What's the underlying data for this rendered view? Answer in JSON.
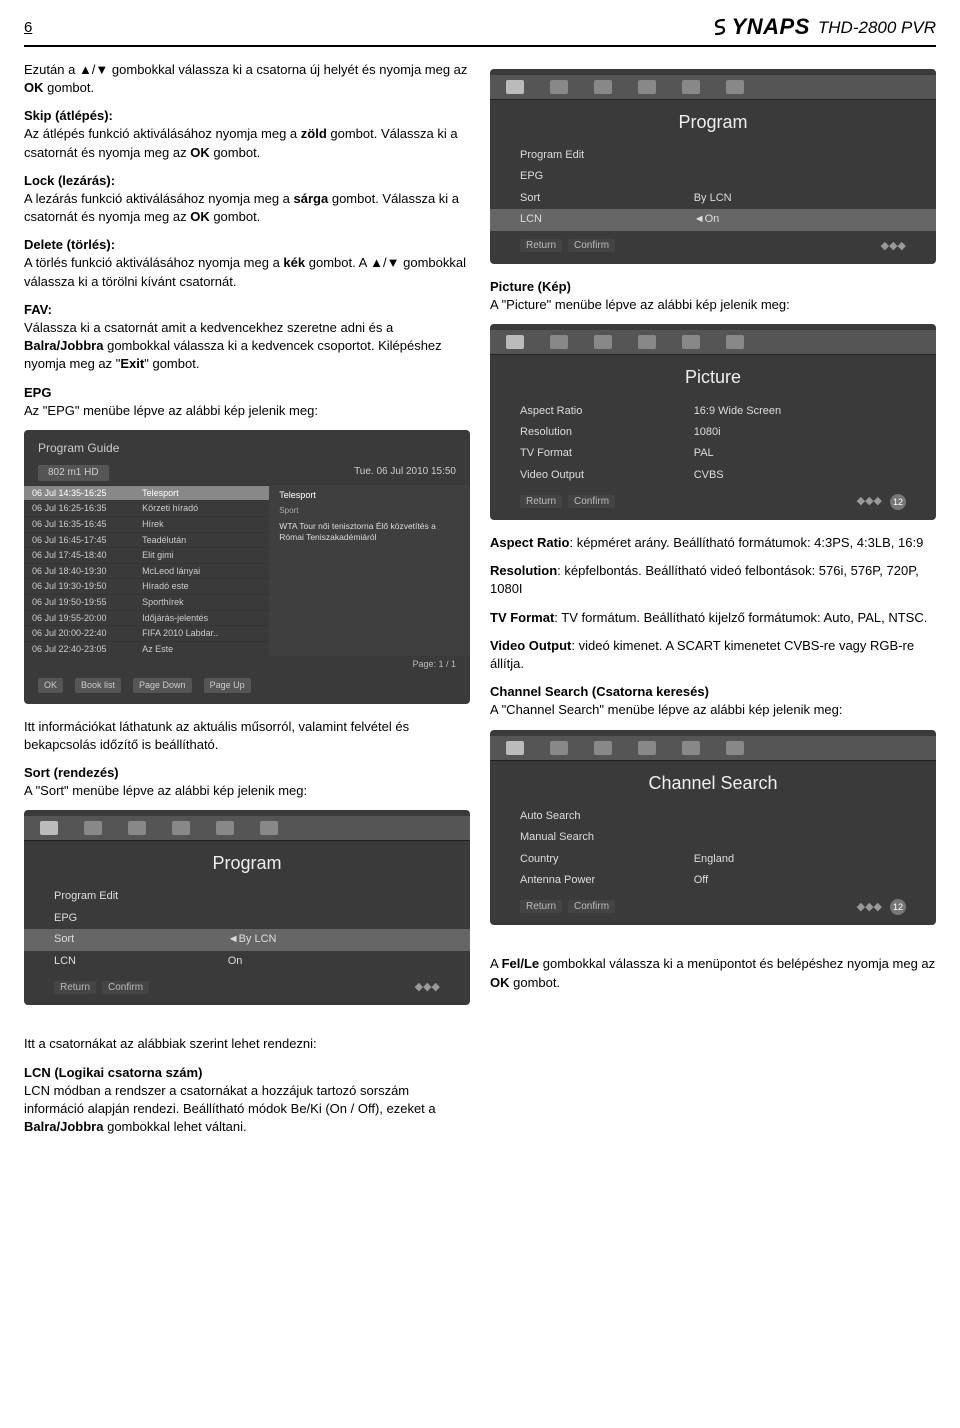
{
  "header": {
    "pageNumber": "6",
    "brand": "YNAPS",
    "model": "THD-2800 PVR"
  },
  "left": {
    "intro": {
      "pre": "Ezután a ",
      "tri": "▲/▼",
      "post": " gombokkal válassza ki a csatorna új helyét és nyomja meg az ",
      "ok": "OK",
      "end": " gombot."
    },
    "skip": {
      "title": "Skip (átlépés):",
      "text1": "Az átlépés funkció aktiválásához nyomja meg a ",
      "green": "zöld",
      "text2": " gombot. Válassza ki a csatornát és nyomja meg az ",
      "ok": "OK",
      "text3": " gombot."
    },
    "lock": {
      "title": "Lock (lezárás):",
      "text1": "A lezárás funkció aktiválásához nyomja meg a ",
      "yellow": "sárga",
      "text2": " gombot. Válassza ki a csatornát és nyomja meg az ",
      "ok": "OK",
      "text3": " gombot."
    },
    "delete": {
      "title": "Delete (törlés):",
      "text1": "A törlés funkció aktiválásához nyomja meg a ",
      "blue": "kék",
      "text2": " gombot. A ",
      "tri": "▲/▼",
      "text3": " gombokkal válassza ki a törölni kívánt csatornát."
    },
    "fav": {
      "title": "FAV:",
      "text1": "Válassza ki a csatornát amit a kedvencekhez szeretne adni és a ",
      "lr": "Balra/Jobbra",
      "text2": " gombokkal válassza ki a kedvencek csoportot. Kilépéshez nyomja meg az \"",
      "exit": "Exit",
      "text3": "\" gombot."
    },
    "epgTitle": "EPG",
    "epgText": "Az \"EPG\" menübe lépve az alábbi kép jelenik meg:",
    "epgShot": {
      "title": "Program Guide",
      "channel": "802 m1 HD",
      "date": "Tue.   06 Jul 2010 15:50",
      "rows": [
        {
          "time": "06 Jul 14:35-16:25",
          "name": "Telesport"
        },
        {
          "time": "06 Jul 16:25-16:35",
          "name": "Körzeti híradó"
        },
        {
          "time": "06 Jul 16:35-16:45",
          "name": "Hírek"
        },
        {
          "time": "06 Jul 16:45-17:45",
          "name": "Teadélután"
        },
        {
          "time": "06 Jul 17:45-18:40",
          "name": "Elit gimi"
        },
        {
          "time": "06 Jul 18:40-19:30",
          "name": "McLeod lányai"
        },
        {
          "time": "06 Jul 19:30-19:50",
          "name": "Híradó este"
        },
        {
          "time": "06 Jul 19:50-19:55",
          "name": "Sporthírek"
        },
        {
          "time": "06 Jul 19:55-20:00",
          "name": "Időjárás-jelentés"
        },
        {
          "time": "06 Jul 20:00-22:40",
          "name": "FIFA 2010 Labdar.."
        },
        {
          "time": "06 Jul 22:40-23:05",
          "name": "Az Este"
        }
      ],
      "detailTitle": "Telesport",
      "detailSub": "Sport",
      "detailText": "WTA Tour női tenisztorna Élő közvetítés a Római Teniszakadémiáról",
      "page": "Page: 1 / 1",
      "footer": [
        "OK",
        "Book list",
        "Page Down",
        "Page Up"
      ]
    },
    "afterEpg": "Itt információkat láthatunk az aktuális műsorról, valamint felvétel és bekapcsolás időzítő is beállítható.",
    "sortTitle": "Sort (rendezés)",
    "sortText": "A \"Sort\" menübe lépve az alábbi kép jelenik meg:",
    "sortShot": {
      "title": "Program",
      "rows": [
        {
          "k": "Program Edit",
          "v": ""
        },
        {
          "k": "EPG",
          "v": ""
        },
        {
          "k": "Sort",
          "v": "◄By LCN"
        },
        {
          "k": "LCN",
          "v": "On"
        }
      ],
      "footerL": "Return",
      "footerR": "Confirm"
    },
    "afterSort": "Itt a csatornákat az alábbiak szerint lehet rendezni:",
    "lcnTitle": "LCN (Logikai csatorna szám)",
    "lcnText": {
      "a": "LCN módban a rendszer a csatornákat a hozzájuk tartozó sorszám információ alapján rendezi. Beállítható módok Be/Ki (On / Off), ezeket a ",
      "b": "Balra/Jobbra",
      "c": " gombokkal lehet váltani."
    }
  },
  "right": {
    "programShot": {
      "title": "Program",
      "rows": [
        {
          "k": "Program Edit",
          "v": ""
        },
        {
          "k": "EPG",
          "v": ""
        },
        {
          "k": "Sort",
          "v": "By LCN"
        },
        {
          "k": "LCN",
          "v": "◄On"
        }
      ],
      "footerL": "Return",
      "footerR": "Confirm"
    },
    "pictureTitle": "Picture (Kép)",
    "pictureText": "A \"Picture\" menübe lépve az alábbi kép jelenik meg:",
    "pictureShot": {
      "title": "Picture",
      "rows": [
        {
          "k": "Aspect Ratio",
          "v": "16:9 Wide Screen"
        },
        {
          "k": "Resolution",
          "v": "1080i"
        },
        {
          "k": "TV Format",
          "v": "PAL"
        },
        {
          "k": "Video Output",
          "v": "CVBS"
        }
      ],
      "footerL": "Return",
      "footerR": "Confirm",
      "badge": "12"
    },
    "aspect": {
      "k": "Aspect Ratio",
      "t": ": képméret arány. Beállítható formátumok: 4:3PS, 4:3LB, 16:9"
    },
    "resolution": {
      "k": "Resolution",
      "t": ": képfelbontás. Beállítható videó felbontások: 576i, 576P, 720P, 1080I"
    },
    "tvformat": {
      "k": "TV Format",
      "t": ": TV formátum. Beállítható kijelző formátumok: Auto, PAL, NTSC."
    },
    "videoout": {
      "k": "Video Output",
      "t": ": videó kimenet. A SCART kimenetet CVBS-re vagy RGB-re állítja."
    },
    "csTitle": "Channel Search (Csatorna keresés)",
    "csText": "A \"Channel Search\" menübe lépve az alábbi kép jelenik meg:",
    "csShot": {
      "title": "Channel Search",
      "rows": [
        {
          "k": "Auto Search",
          "v": ""
        },
        {
          "k": "Manual Search",
          "v": ""
        },
        {
          "k": "Country",
          "v": "England"
        },
        {
          "k": "Antenna Power",
          "v": "Off"
        }
      ],
      "footerL": "Return",
      "footerR": "Confirm",
      "badge": "12"
    },
    "csAfter": {
      "a": "A ",
      "b": "Fel/Le",
      "c": " gombokkal válassza ki a menüpontot és belépéshez nyomja meg az ",
      "ok": "OK",
      "d": " gombot."
    }
  }
}
